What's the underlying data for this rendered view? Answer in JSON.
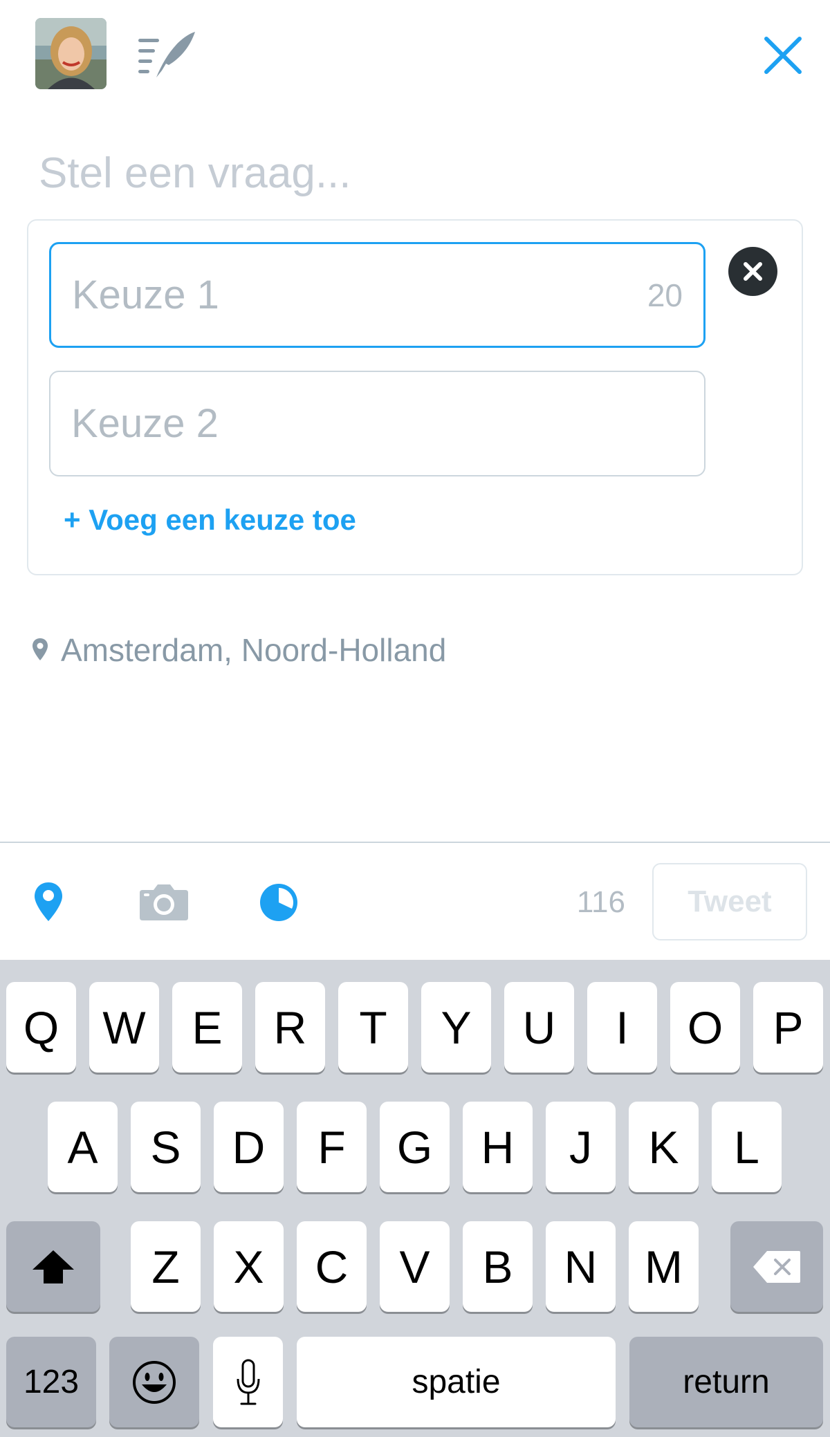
{
  "header": {
    "avatar": "avatar",
    "drafts_icon": "drafts-quill-icon",
    "close_icon": "close-icon"
  },
  "question": {
    "placeholder": "Stel een vraag..."
  },
  "poll": {
    "choice1": {
      "placeholder": "Keuze 1",
      "char_count": "20"
    },
    "choice2": {
      "placeholder": "Keuze 2"
    },
    "add_choice_label": "+ Voeg een keuze toe",
    "remove_icon": "remove-choice-icon"
  },
  "location": {
    "label": "Amsterdam, Noord-Holland"
  },
  "toolbar": {
    "char_count": "116",
    "tweet_label": "Tweet",
    "icons": [
      "location-pin-icon",
      "camera-icon",
      "poll-icon"
    ]
  },
  "colors": {
    "accent": "#1da1f2",
    "placeholder": "#c5ccd4",
    "muted": "#8899a6",
    "keyboard_bg": "#d1d5db"
  },
  "keyboard": {
    "row1": [
      "Q",
      "W",
      "E",
      "R",
      "T",
      "Y",
      "U",
      "I",
      "O",
      "P"
    ],
    "row2": [
      "A",
      "S",
      "D",
      "F",
      "G",
      "H",
      "J",
      "K",
      "L"
    ],
    "row3": [
      "Z",
      "X",
      "C",
      "V",
      "B",
      "N",
      "M"
    ],
    "numbers_label": "123",
    "space_label": "spatie",
    "return_label": "return",
    "icons": [
      "shift-icon",
      "backspace-icon",
      "emoji-icon",
      "microphone-icon"
    ]
  }
}
